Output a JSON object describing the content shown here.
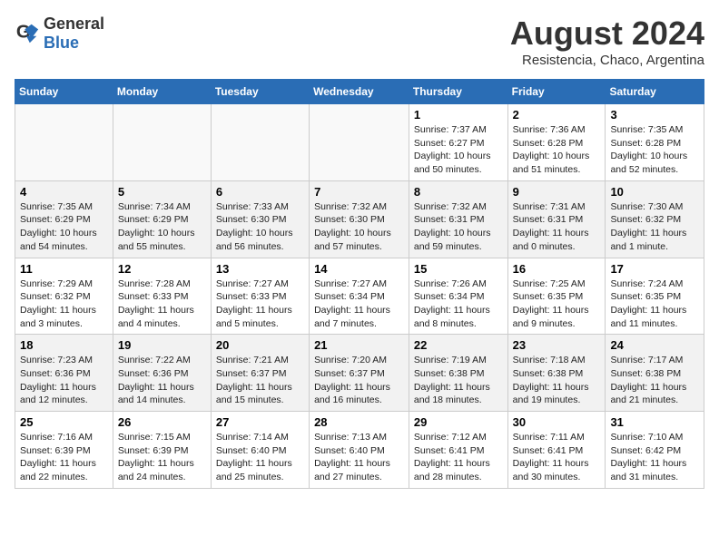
{
  "logo": {
    "general": "General",
    "blue": "Blue"
  },
  "title": "August 2024",
  "location": "Resistencia, Chaco, Argentina",
  "days_of_week": [
    "Sunday",
    "Monday",
    "Tuesday",
    "Wednesday",
    "Thursday",
    "Friday",
    "Saturday"
  ],
  "weeks": [
    [
      {
        "day": "",
        "info": ""
      },
      {
        "day": "",
        "info": ""
      },
      {
        "day": "",
        "info": ""
      },
      {
        "day": "",
        "info": ""
      },
      {
        "day": "1",
        "info": "Sunrise: 7:37 AM\nSunset: 6:27 PM\nDaylight: 10 hours\nand 50 minutes."
      },
      {
        "day": "2",
        "info": "Sunrise: 7:36 AM\nSunset: 6:28 PM\nDaylight: 10 hours\nand 51 minutes."
      },
      {
        "day": "3",
        "info": "Sunrise: 7:35 AM\nSunset: 6:28 PM\nDaylight: 10 hours\nand 52 minutes."
      }
    ],
    [
      {
        "day": "4",
        "info": "Sunrise: 7:35 AM\nSunset: 6:29 PM\nDaylight: 10 hours\nand 54 minutes."
      },
      {
        "day": "5",
        "info": "Sunrise: 7:34 AM\nSunset: 6:29 PM\nDaylight: 10 hours\nand 55 minutes."
      },
      {
        "day": "6",
        "info": "Sunrise: 7:33 AM\nSunset: 6:30 PM\nDaylight: 10 hours\nand 56 minutes."
      },
      {
        "day": "7",
        "info": "Sunrise: 7:32 AM\nSunset: 6:30 PM\nDaylight: 10 hours\nand 57 minutes."
      },
      {
        "day": "8",
        "info": "Sunrise: 7:32 AM\nSunset: 6:31 PM\nDaylight: 10 hours\nand 59 minutes."
      },
      {
        "day": "9",
        "info": "Sunrise: 7:31 AM\nSunset: 6:31 PM\nDaylight: 11 hours\nand 0 minutes."
      },
      {
        "day": "10",
        "info": "Sunrise: 7:30 AM\nSunset: 6:32 PM\nDaylight: 11 hours\nand 1 minute."
      }
    ],
    [
      {
        "day": "11",
        "info": "Sunrise: 7:29 AM\nSunset: 6:32 PM\nDaylight: 11 hours\nand 3 minutes."
      },
      {
        "day": "12",
        "info": "Sunrise: 7:28 AM\nSunset: 6:33 PM\nDaylight: 11 hours\nand 4 minutes."
      },
      {
        "day": "13",
        "info": "Sunrise: 7:27 AM\nSunset: 6:33 PM\nDaylight: 11 hours\nand 5 minutes."
      },
      {
        "day": "14",
        "info": "Sunrise: 7:27 AM\nSunset: 6:34 PM\nDaylight: 11 hours\nand 7 minutes."
      },
      {
        "day": "15",
        "info": "Sunrise: 7:26 AM\nSunset: 6:34 PM\nDaylight: 11 hours\nand 8 minutes."
      },
      {
        "day": "16",
        "info": "Sunrise: 7:25 AM\nSunset: 6:35 PM\nDaylight: 11 hours\nand 9 minutes."
      },
      {
        "day": "17",
        "info": "Sunrise: 7:24 AM\nSunset: 6:35 PM\nDaylight: 11 hours\nand 11 minutes."
      }
    ],
    [
      {
        "day": "18",
        "info": "Sunrise: 7:23 AM\nSunset: 6:36 PM\nDaylight: 11 hours\nand 12 minutes."
      },
      {
        "day": "19",
        "info": "Sunrise: 7:22 AM\nSunset: 6:36 PM\nDaylight: 11 hours\nand 14 minutes."
      },
      {
        "day": "20",
        "info": "Sunrise: 7:21 AM\nSunset: 6:37 PM\nDaylight: 11 hours\nand 15 minutes."
      },
      {
        "day": "21",
        "info": "Sunrise: 7:20 AM\nSunset: 6:37 PM\nDaylight: 11 hours\nand 16 minutes."
      },
      {
        "day": "22",
        "info": "Sunrise: 7:19 AM\nSunset: 6:38 PM\nDaylight: 11 hours\nand 18 minutes."
      },
      {
        "day": "23",
        "info": "Sunrise: 7:18 AM\nSunset: 6:38 PM\nDaylight: 11 hours\nand 19 minutes."
      },
      {
        "day": "24",
        "info": "Sunrise: 7:17 AM\nSunset: 6:38 PM\nDaylight: 11 hours\nand 21 minutes."
      }
    ],
    [
      {
        "day": "25",
        "info": "Sunrise: 7:16 AM\nSunset: 6:39 PM\nDaylight: 11 hours\nand 22 minutes."
      },
      {
        "day": "26",
        "info": "Sunrise: 7:15 AM\nSunset: 6:39 PM\nDaylight: 11 hours\nand 24 minutes."
      },
      {
        "day": "27",
        "info": "Sunrise: 7:14 AM\nSunset: 6:40 PM\nDaylight: 11 hours\nand 25 minutes."
      },
      {
        "day": "28",
        "info": "Sunrise: 7:13 AM\nSunset: 6:40 PM\nDaylight: 11 hours\nand 27 minutes."
      },
      {
        "day": "29",
        "info": "Sunrise: 7:12 AM\nSunset: 6:41 PM\nDaylight: 11 hours\nand 28 minutes."
      },
      {
        "day": "30",
        "info": "Sunrise: 7:11 AM\nSunset: 6:41 PM\nDaylight: 11 hours\nand 30 minutes."
      },
      {
        "day": "31",
        "info": "Sunrise: 7:10 AM\nSunset: 6:42 PM\nDaylight: 11 hours\nand 31 minutes."
      }
    ]
  ]
}
